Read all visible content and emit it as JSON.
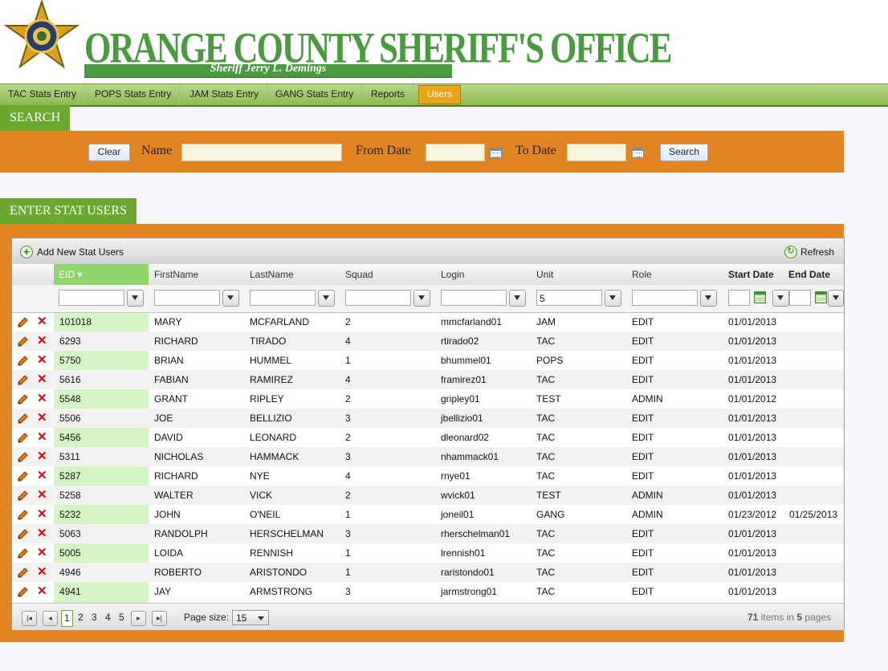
{
  "header": {
    "title": "ORANGE COUNTY SHERIFF'S OFFICE",
    "subtitle": "Sheriff Jerry L. Demings"
  },
  "menu": [
    {
      "label": "TAC Stats Entry",
      "active": false
    },
    {
      "label": "POPS Stats Entry",
      "active": false
    },
    {
      "label": "JAM Stats Entry",
      "active": false
    },
    {
      "label": "GANG Stats Entry",
      "active": false
    },
    {
      "label": "Reports",
      "active": false
    },
    {
      "label": "Users",
      "active": true
    }
  ],
  "search": {
    "section_title": "SEARCH",
    "clear_label": "Clear",
    "name_label": "Name",
    "name_value": "",
    "from_label": "From Date",
    "from_value": "",
    "to_label": "To Date",
    "to_value": "",
    "search_label": "Search"
  },
  "users_section": {
    "title": "ENTER STAT USERS"
  },
  "grid": {
    "add_label": "Add New Stat Users",
    "refresh_label": "Refresh",
    "columns": [
      "EID",
      "FirstName",
      "LastName",
      "Squad",
      "Login",
      "Unit",
      "Role",
      "Start Date",
      "End Date"
    ],
    "filters": {
      "unit": "5"
    },
    "rows": [
      [
        "101018",
        "MARY",
        "MCFARLAND",
        "2",
        "mmcfarland01",
        "JAM",
        "EDIT",
        "01/01/2013",
        ""
      ],
      [
        "6293",
        "RICHARD",
        "TIRADO",
        "4",
        "rtirado02",
        "TAC",
        "EDIT",
        "01/01/2013",
        ""
      ],
      [
        "5750",
        "BRIAN",
        "HUMMEL",
        "1",
        "bhummel01",
        "POPS",
        "EDIT",
        "01/01/2013",
        ""
      ],
      [
        "5616",
        "FABIAN",
        "RAMIREZ",
        "4",
        "framirez01",
        "TAC",
        "EDIT",
        "01/01/2013",
        ""
      ],
      [
        "5548",
        "GRANT",
        "RIPLEY",
        "2",
        "gripley01",
        "TEST",
        "ADMIN",
        "01/01/2012",
        ""
      ],
      [
        "5506",
        "JOE",
        "BELLIZIO",
        "3",
        "jbellizio01",
        "TAC",
        "EDIT",
        "01/01/2013",
        ""
      ],
      [
        "5456",
        "DAVID",
        "LEONARD",
        "2",
        "dleonard02",
        "TAC",
        "EDIT",
        "01/01/2013",
        ""
      ],
      [
        "5311",
        "NICHOLAS",
        "HAMMACK",
        "3",
        "nhammack01",
        "TAC",
        "EDIT",
        "01/01/2013",
        ""
      ],
      [
        "5287",
        "RICHARD",
        "NYE",
        "4",
        "rnye01",
        "TAC",
        "EDIT",
        "01/01/2013",
        ""
      ],
      [
        "5258",
        "WALTER",
        "VICK",
        "2",
        "wvick01",
        "TEST",
        "ADMIN",
        "01/01/2013",
        ""
      ],
      [
        "5232",
        "JOHN",
        "O'NEIL",
        "1",
        "joneil01",
        "GANG",
        "ADMIN",
        "01/23/2012",
        "01/25/2013"
      ],
      [
        "5063",
        "RANDOLPH",
        "HERSCHELMAN",
        "3",
        "rherschelman01",
        "TAC",
        "EDIT",
        "01/01/2013",
        ""
      ],
      [
        "5005",
        "LOIDA",
        "RENNISH",
        "1",
        "lrennish01",
        "TAC",
        "EDIT",
        "01/01/2013",
        ""
      ],
      [
        "4946",
        "ROBERTO",
        "ARISTONDO",
        "1",
        "raristondo01",
        "TAC",
        "EDIT",
        "01/01/2013",
        ""
      ],
      [
        "4941",
        "JAY",
        "ARMSTRONG",
        "3",
        "jarmstrong01",
        "TAC",
        "EDIT",
        "01/01/2013",
        ""
      ]
    ]
  },
  "pager": {
    "pages": [
      "1",
      "2",
      "3",
      "4",
      "5"
    ],
    "current": "1",
    "page_size_label": "Page size:",
    "page_size": "15",
    "items_count": "71",
    "items_mid": "items in",
    "pages_count": "5",
    "pages_word": "pages"
  },
  "colors": {
    "accent_green": "#6aa82f",
    "orange": "#e28422",
    "active_menu": "#e9a41a"
  }
}
